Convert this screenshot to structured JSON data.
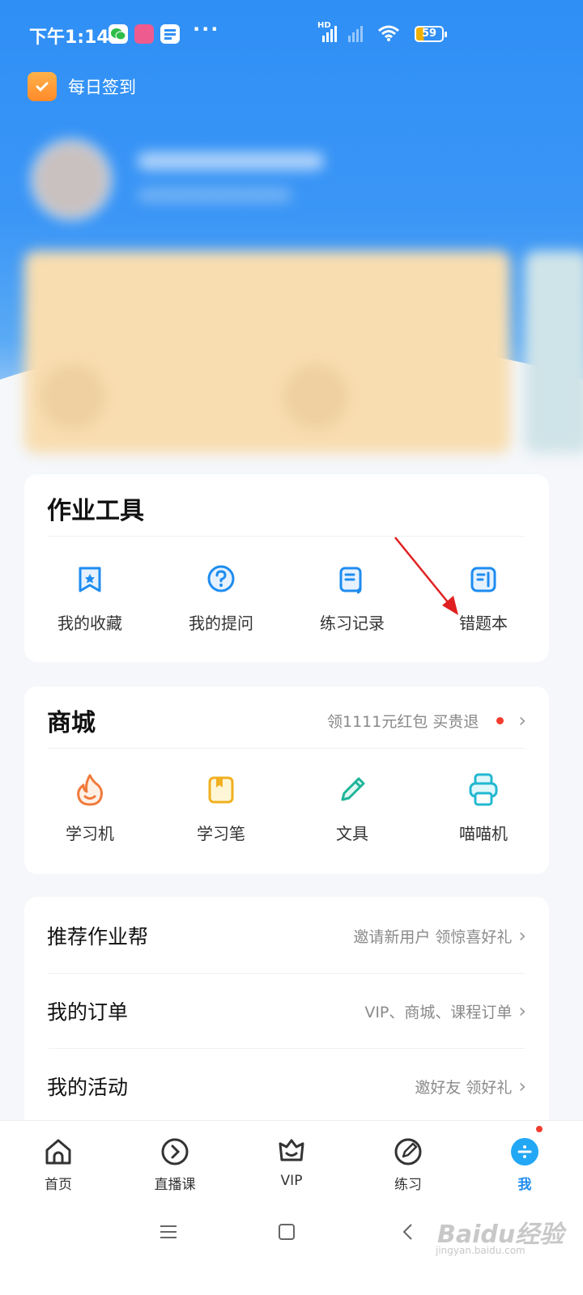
{
  "status_bar": {
    "time": "下午1:14",
    "more": "···",
    "battery": "59",
    "network_label": "HD"
  },
  "checkin": {
    "label": "每日签到"
  },
  "homework_tools": {
    "title": "作业工具",
    "items": [
      {
        "label": "我的收藏",
        "icon": "bookmark-star-icon"
      },
      {
        "label": "我的提问",
        "icon": "question-bubble-icon"
      },
      {
        "label": "练习记录",
        "icon": "practice-record-icon"
      },
      {
        "label": "错题本",
        "icon": "mistake-book-icon"
      }
    ]
  },
  "mall": {
    "title": "商城",
    "promo": "领1111元红包 买贵退",
    "items": [
      {
        "label": "学习机",
        "icon": "flame-icon"
      },
      {
        "label": "学习笔",
        "icon": "notebook-icon"
      },
      {
        "label": "文具",
        "icon": "pencil-icon"
      },
      {
        "label": "喵喵机",
        "icon": "printer-icon"
      }
    ]
  },
  "menu": [
    {
      "label": "推荐作业帮",
      "hint": "邀请新用户 领惊喜好礼"
    },
    {
      "label": "我的订单",
      "hint": "VIP、商城、课程订单"
    },
    {
      "label": "我的活动",
      "hint": "邀好友 领好礼"
    }
  ],
  "bottom_nav": [
    {
      "label": "首页",
      "icon": "home-icon"
    },
    {
      "label": "直播课",
      "icon": "play-circle-icon"
    },
    {
      "label": "VIP",
      "icon": "vip-crown-icon"
    },
    {
      "label": "练习",
      "icon": "compass-pen-icon"
    },
    {
      "label": "我",
      "icon": "me-icon",
      "active": true
    }
  ],
  "watermark": {
    "text": "Baidu经验",
    "sub": "jingyan.baidu.com"
  },
  "colors": {
    "primary": "#1e8cf0",
    "accent_red": "#f23c2e",
    "annotation_arrow": "#e02020"
  }
}
